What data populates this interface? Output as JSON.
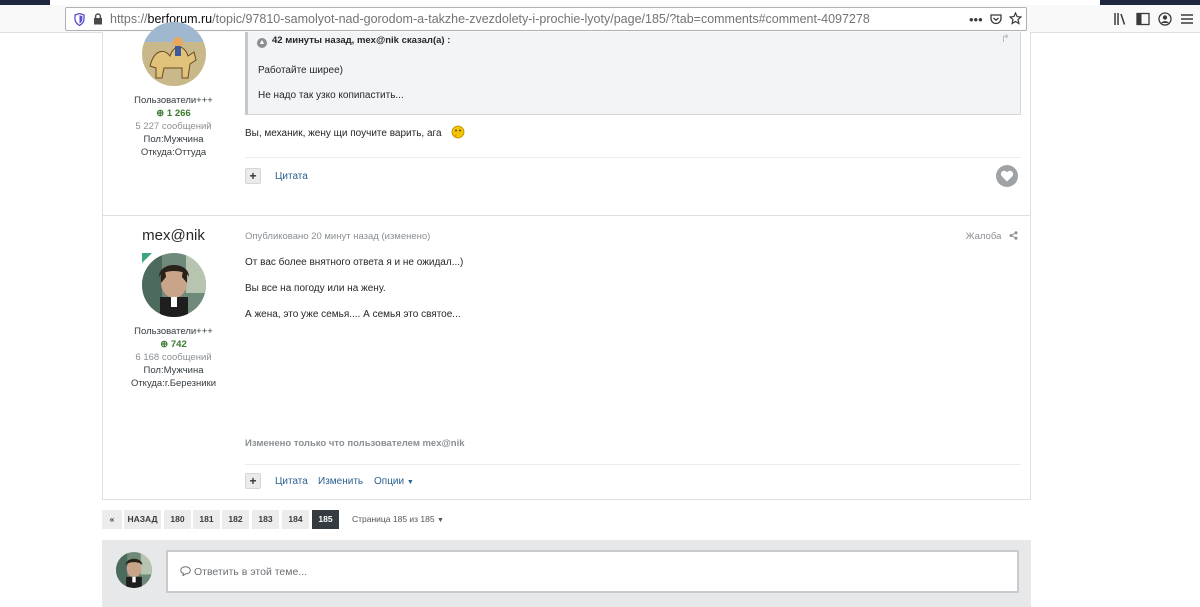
{
  "browser": {
    "url_prefix": "https://",
    "url_domain": "berforum.ru",
    "url_path": "/topic/97810-samolyot-nad-gorodom-a-takzhe-zvezdolety-i-prochie-lyoty/page/185/?tab=comments#comment-4097278",
    "menu_dots": "•••"
  },
  "post1": {
    "author_group": "Пользователи+++",
    "reputation": "1 266",
    "posts_count": "5 227 сообщений",
    "gender": "Пол:Мужчина",
    "location": "Откуда:Оттуда",
    "quote_header": "42 минуты назад, mex@nik сказал(а) :",
    "quote_line1": "Работайте ширее)",
    "quote_line2": "Не надо так узко копипастить...",
    "text": "Вы, механик, жену щи поучите варить, ага",
    "quote_button": "Цитата"
  },
  "post2": {
    "author_name": "mex@nik",
    "author_group": "Пользователи+++",
    "reputation": "742",
    "posts_count": "6 168 сообщений",
    "gender": "Пол:Мужчина",
    "location": "Откуда:г.Березники",
    "meta": "Опубликовано 20 минут назад (изменено)",
    "report": "Жалоба",
    "line1": "От вас более внятного ответа я и не ожидал...)",
    "line2": "Вы все на погоду или на жену.",
    "line3": "А жена, это уже семья.... А семья это святое...",
    "edited_note": "Изменено только что пользователем mex@nik",
    "quote_button": "Цитата",
    "edit_button": "Изменить",
    "options_button": "Опции"
  },
  "pagination": {
    "first": "«",
    "prev": "НАЗАД",
    "pages": [
      "180",
      "181",
      "182",
      "183",
      "184",
      "185"
    ],
    "current": "185",
    "info": "Страница 185 из 185"
  },
  "reply": {
    "placeholder": "Ответить в этой теме..."
  },
  "colors": {
    "accent": "#2a5f8f",
    "reputation": "#3b7a2e",
    "active_page": "#353c41"
  }
}
